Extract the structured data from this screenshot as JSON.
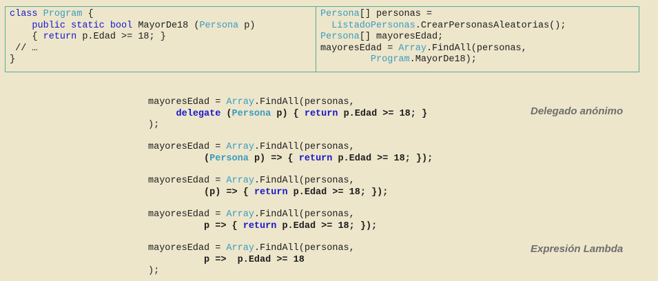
{
  "top_left_code": {
    "line1": {
      "kw1": "class",
      "type": "Program",
      "rest": " {"
    },
    "line2": {
      "indent": "    ",
      "kw": "public static bool",
      "name": " MayorDe18 (",
      "type": "Persona",
      "rest": " p)"
    },
    "line3": {
      "indent": "    ",
      "open": "{ ",
      "kw": "return",
      "rest": " p.Edad >= 18; }"
    },
    "line4": {
      "text": " // …"
    },
    "line5": {
      "text": "}"
    }
  },
  "top_right_code": {
    "line1": {
      "type": "Persona",
      "rest": "[] personas ="
    },
    "line2": {
      "indent": "  ",
      "type": "ListadoPersonas",
      "rest": ".CrearPersonasAleatorias();"
    },
    "line3": {
      "type": "Persona",
      "rest": "[] mayoresEdad;"
    },
    "line4": {
      "start": "mayoresEdad = ",
      "type": "Array",
      "rest": ".FindAll(personas,"
    },
    "line5": {
      "indent": "         ",
      "type": "Program",
      "rest": ".MayorDe18);"
    }
  },
  "examples": [
    {
      "head": {
        "start": "mayoresEdad = ",
        "type": "Array",
        "rest": ".FindAll(personas,"
      },
      "body": {
        "indent": "     ",
        "kw1": "delegate",
        "p1": " (",
        "type": "Persona",
        "p2": " p) { ",
        "kw2": "return",
        "p3": " p.Edad >= 18; }"
      },
      "tail": ");"
    },
    {
      "head": {
        "start": "mayoresEdad = ",
        "type": "Array",
        "rest": ".FindAll(personas,"
      },
      "body": {
        "indent": "          ",
        "p1": "(",
        "type": "Persona",
        "p2": " p) => { ",
        "kw2": "return",
        "p3": " p.Edad >= 18; });"
      }
    },
    {
      "head": {
        "start": "mayoresEdad = ",
        "type": "Array",
        "rest": ".FindAll(personas,"
      },
      "body": {
        "indent": "          ",
        "p1": "(p) => { ",
        "kw2": "return",
        "p3": " p.Edad >= 18; });"
      }
    },
    {
      "head": {
        "start": "mayoresEdad = ",
        "type": "Array",
        "rest": ".FindAll(personas,"
      },
      "body": {
        "indent": "          ",
        "p1": "p => { ",
        "kw2": "return",
        "p3": " p.Edad >= 18; });"
      }
    },
    {
      "head": {
        "start": "mayoresEdad = ",
        "type": "Array",
        "rest": ".FindAll(personas,"
      },
      "body": {
        "indent": "          ",
        "p1": "p =>  p.Edad >= 18"
      },
      "tail": ");"
    }
  ],
  "notes": {
    "delegate": "Delegado anónimo",
    "lambda": "Expresión Lambda"
  },
  "colors": {
    "background": "#ede6cb",
    "keyword": "#1818c8",
    "type": "#3a9cbf",
    "border": "#5aa894",
    "note": "#6e6e6e"
  }
}
